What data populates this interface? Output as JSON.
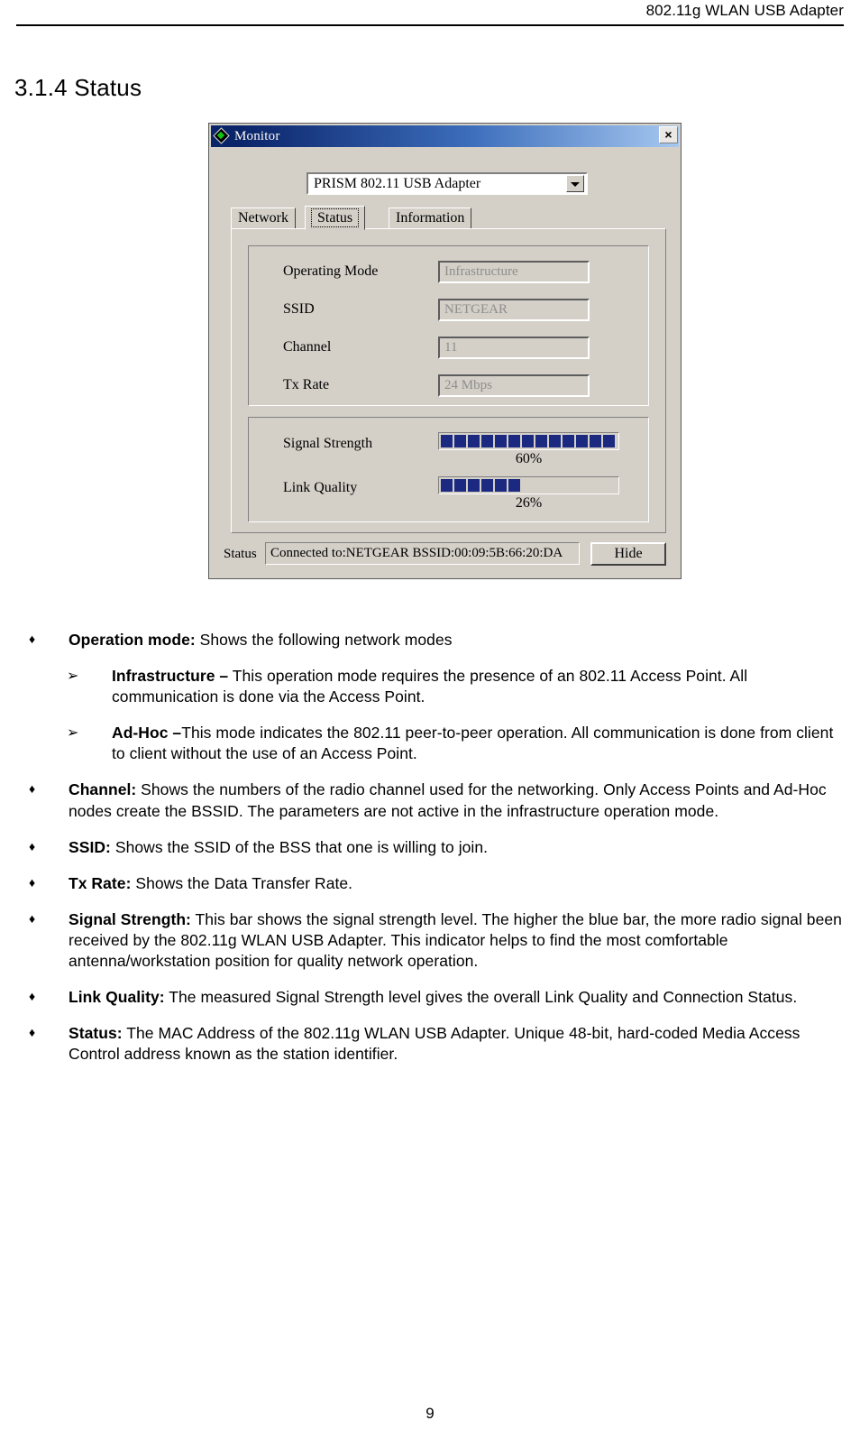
{
  "header": {
    "running_head": "802.11g WLAN USB Adapter"
  },
  "section": {
    "title": "3.1.4 Status"
  },
  "dialog": {
    "title": "Monitor",
    "icon": "green-diamond-icon",
    "close_label": "×",
    "adapter_select": {
      "value": "PRISM 802.11 USB Adapter"
    },
    "tabs": [
      {
        "label": "Network",
        "active": false
      },
      {
        "label": "Status",
        "active": true
      },
      {
        "label": "Information",
        "active": false
      }
    ],
    "fields": [
      {
        "label": "Operating Mode",
        "value": "Infrastructure"
      },
      {
        "label": "SSID",
        "value": "NETGEAR"
      },
      {
        "label": "Channel",
        "value": "11"
      },
      {
        "label": "Tx Rate",
        "value": "24 Mbps"
      }
    ],
    "meters": [
      {
        "label": "Signal Strength",
        "percent": "60%",
        "blocks": 13,
        "color": "#1b2a80"
      },
      {
        "label": "Link Quality",
        "percent": "26%",
        "blocks": 6,
        "color": "#1b2a80"
      }
    ],
    "statusbar": {
      "label": "Status",
      "value": "Connected to:NETGEAR    BSSID:00:09:5B:66:20:DA",
      "hide_button": "Hide"
    }
  },
  "bullets": [
    {
      "glyph": "♦",
      "level": 0,
      "term": "Operation mode:",
      "text": " Shows the following network modes"
    },
    {
      "glyph": "➢",
      "level": 1,
      "term": "Infrastructure –",
      "text": " This operation mode requires the presence of an 802.11 Access Point. All communication is done via the Access Point."
    },
    {
      "glyph": "➢",
      "level": 1,
      "term": "Ad-Hoc –",
      "text": "This mode indicates the 802.11 peer-to-peer operation. All communication is done from client to client without the use of an Access Point."
    },
    {
      "glyph": "♦",
      "level": 0,
      "term": "Channel:",
      "text": " Shows the numbers of the radio channel used for the networking. Only Access Points and Ad-Hoc nodes create the BSSID. The parameters are not active in the infrastructure operation mode."
    },
    {
      "glyph": "♦",
      "level": 0,
      "term": "SSID:",
      "text": " Shows the SSID of the BSS that one is willing to join."
    },
    {
      "glyph": "♦",
      "level": 0,
      "term": "Tx Rate:",
      "text": " Shows the Data Transfer Rate."
    },
    {
      "glyph": "♦",
      "level": 0,
      "term": "Signal Strength:",
      "text": " This bar shows the signal strength level. The higher the blue bar, the more radio signal been received by the 802.11g WLAN USB Adapter. This indicator helps to find the most comfortable antenna/workstation position for quality network operation."
    },
    {
      "glyph": "♦",
      "level": 0,
      "term": "Link Quality:",
      "text": " The measured Signal Strength level gives the overall Link Quality and Connection Status."
    },
    {
      "glyph": "♦",
      "level": 0,
      "term": "Status:",
      "text": " The MAC Address of the 802.11g WLAN USB Adapter. Unique 48-bit, hard-coded Media Access Control address known as the station identifier."
    }
  ],
  "footer": {
    "page_number": "9"
  }
}
